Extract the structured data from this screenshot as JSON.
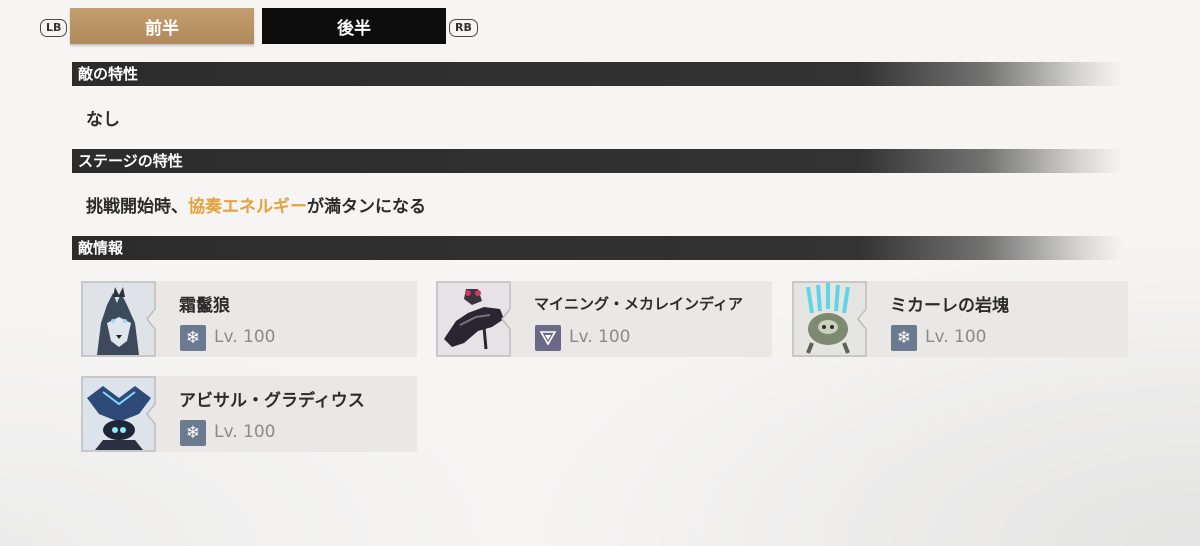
{
  "tabs": {
    "lb_hint": "LB",
    "rb_hint": "RB",
    "first_label": "前半",
    "second_label": "後半"
  },
  "enemy_traits": {
    "heading": "敵の特性",
    "text": "なし"
  },
  "stage_traits": {
    "heading": "ステージの特性",
    "text_before": "挑戦開始時、",
    "text_highlight": "協奏エネルギー",
    "text_after": "が満タンになる",
    "highlight_color": "#e4a13c"
  },
  "enemy_info": {
    "heading": "敵情報",
    "enemies": [
      {
        "name": "霜鬣狼",
        "level": "Lv. 100",
        "attribute_icon": "snowflake-icon"
      },
      {
        "name": "マイニング・メカレインディア",
        "level": "Lv. 100",
        "attribute_icon": "havoc-icon"
      },
      {
        "name": "ミカーレの岩塊",
        "level": "Lv. 100",
        "attribute_icon": "snowflake-icon"
      },
      {
        "name": "アビサル・グラディウス",
        "level": "Lv. 100",
        "attribute_icon": "snowflake-icon"
      }
    ]
  }
}
